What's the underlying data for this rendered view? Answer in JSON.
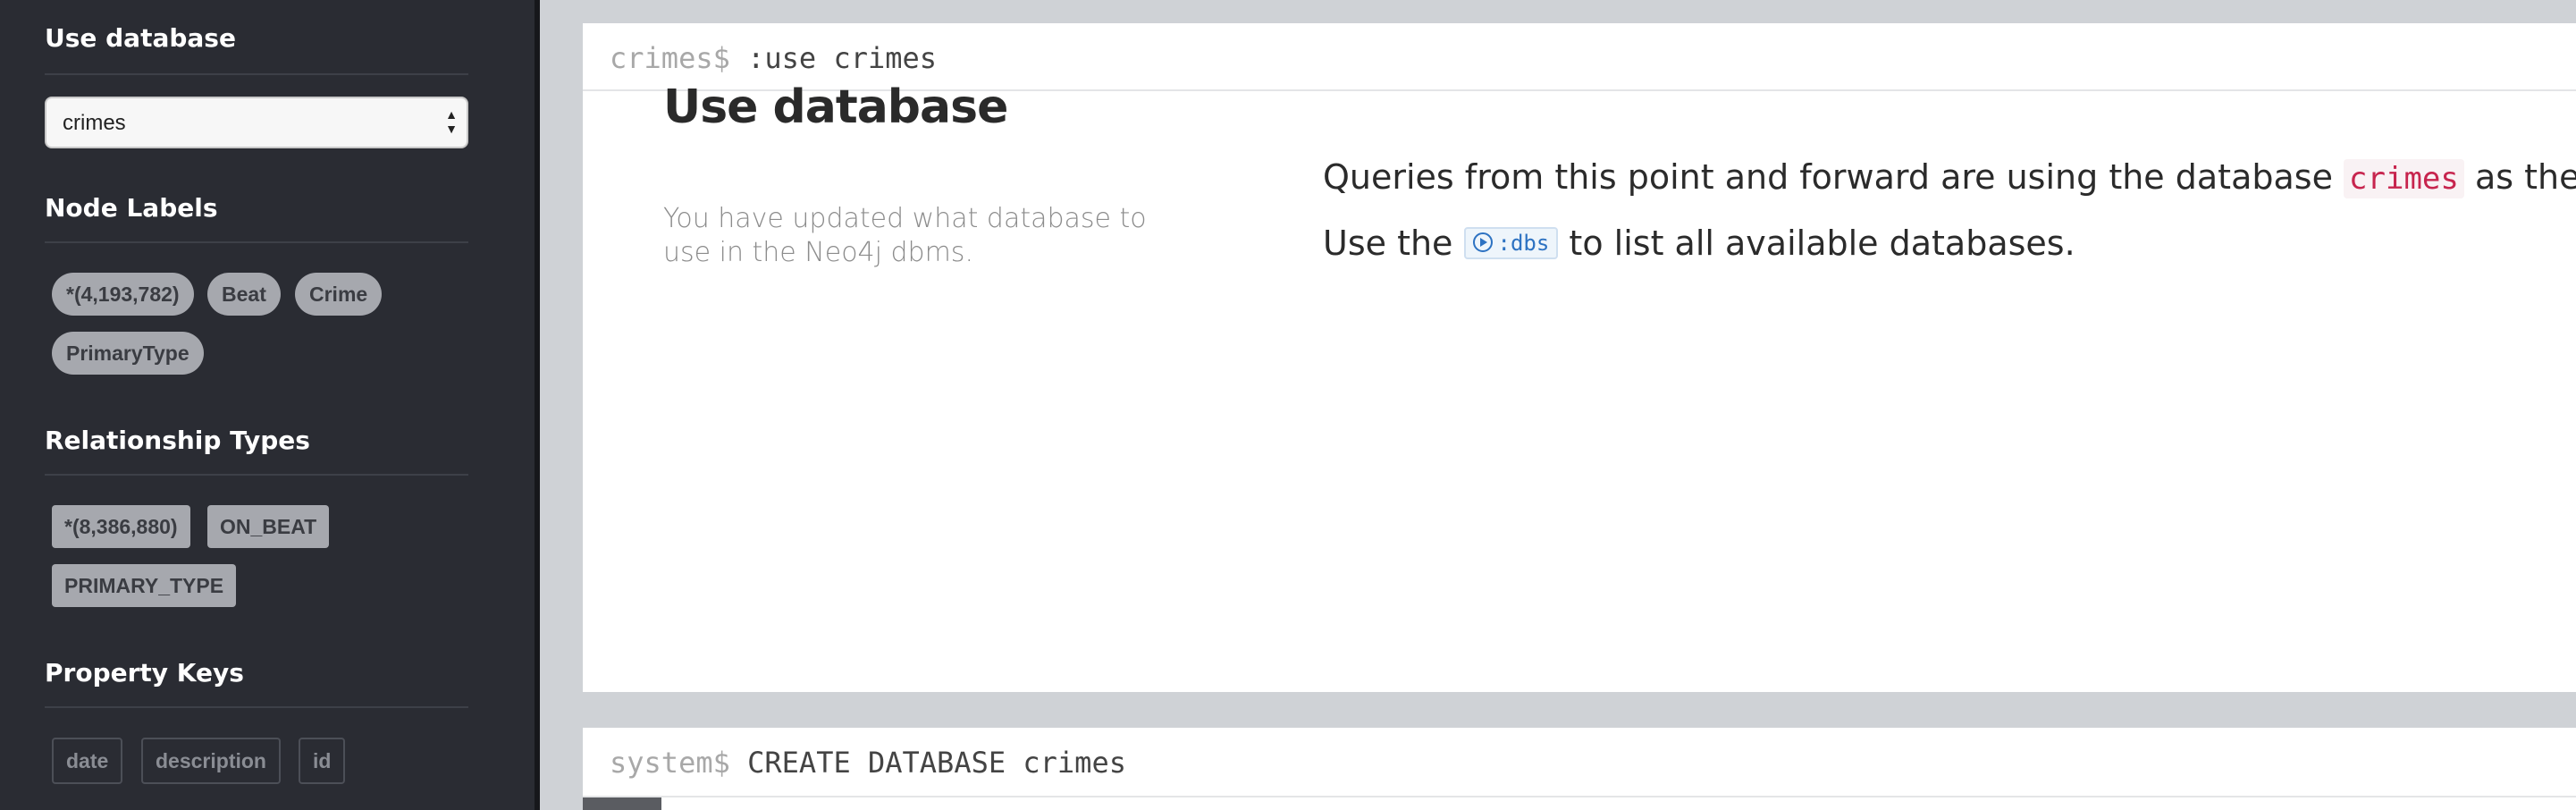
{
  "sidebar": {
    "use_database": {
      "title": "Use database",
      "selected": "crimes"
    },
    "node_labels": {
      "title": "Node Labels",
      "items": [
        "*(4,193,782)",
        "Beat",
        "Crime",
        "PrimaryType"
      ]
    },
    "relationship_types": {
      "title": "Relationship Types",
      "items": [
        "*(8,386,880)",
        "ON_BEAT",
        "PRIMARY_TYPE"
      ]
    },
    "property_keys": {
      "title": "Property Keys",
      "items": [
        "date",
        "description",
        "id"
      ]
    }
  },
  "frames": [
    {
      "prompt": "crimes$",
      "command": ":use crimes",
      "card": {
        "title": "Use database",
        "subtitle": "You have updated what database to use in the Neo4j dbms.",
        "line1_before": "Queries from this point and forward are using the database",
        "line1_db": "crimes",
        "line1_after": "as the target.",
        "line2_before": "Use the",
        "line2_cmd": ":dbs",
        "line2_after": "to list all available databases."
      }
    },
    {
      "prompt": "system$",
      "command": "CREATE DATABASE crimes"
    }
  ],
  "colors": {
    "sidebar_bg": "#2a2c33",
    "pill_bg": "#a6a8ae",
    "db_name": "#c7254e",
    "command_link": "#2d72c2"
  }
}
